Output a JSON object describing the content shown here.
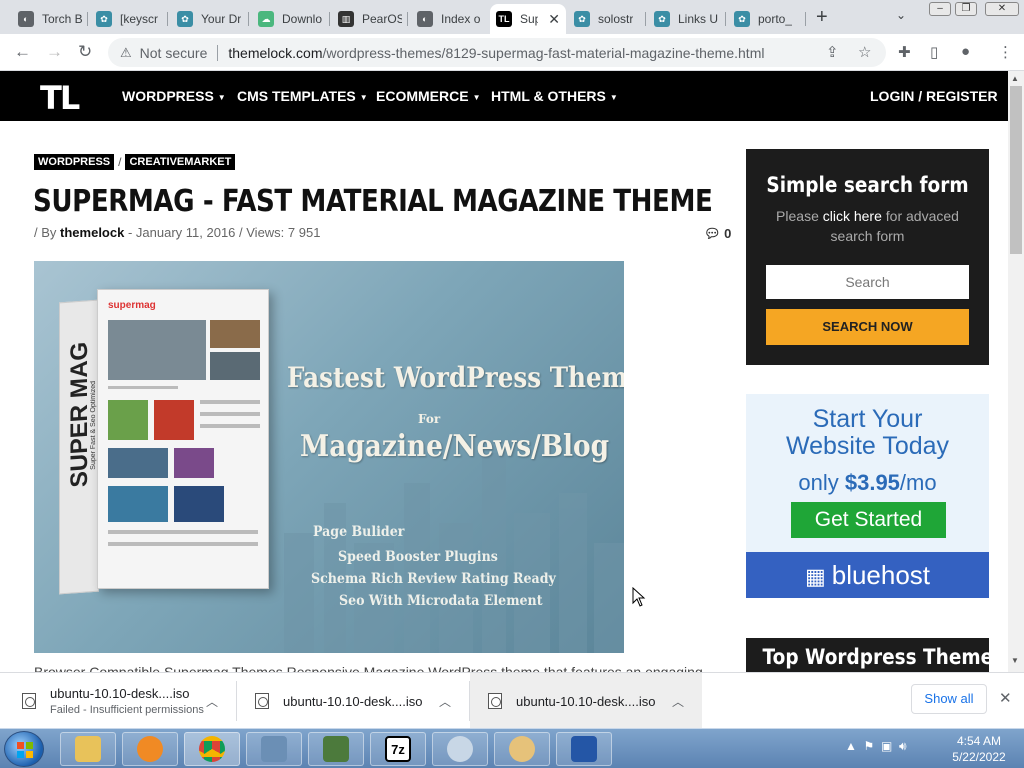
{
  "browser": {
    "tabs": [
      {
        "title": "Torch B",
        "color": "#5f6368",
        "glyph": "◐"
      },
      {
        "title": "[keyscr",
        "color": "#3b8ea5",
        "glyph": "✿"
      },
      {
        "title": "Your Dr",
        "color": "#3b8ea5",
        "glyph": "✿"
      },
      {
        "title": "Downlo",
        "color": "#4bb77e",
        "glyph": "☁"
      },
      {
        "title": "PearOS",
        "color": "#333333",
        "glyph": "▥"
      },
      {
        "title": "Index o",
        "color": "#5f6368",
        "glyph": "◐"
      },
      {
        "title": "Sup",
        "color": "#000000",
        "glyph": "TL"
      },
      {
        "title": "solostr",
        "color": "#3b8ea5",
        "glyph": "✿"
      },
      {
        "title": "Links U",
        "color": "#3b8ea5",
        "glyph": "✿"
      },
      {
        "title": "porto_",
        "color": "#3b8ea5",
        "glyph": "✿"
      }
    ],
    "security_label": "Not secure",
    "url_domain": "themelock.com",
    "url_path": "/wordpress-themes/8129-supermag-fast-material-magazine-theme.html"
  },
  "site": {
    "logo": "TL",
    "nav": [
      "WORDPRESS",
      "CMS TEMPLATES",
      "ECOMMERCE",
      "HTML & OTHERS"
    ],
    "login": "LOGIN / REGISTER"
  },
  "post": {
    "categories": [
      "WORDPRESS",
      "CREATIVEMARKET"
    ],
    "title": "SUPERMAG - FAST MATERIAL MAGAZINE THEME",
    "meta_by": "/ By",
    "author": "themelock",
    "meta_rest": "- January 11, 2016 / Views: 7 951",
    "comment_count": "0",
    "hero": {
      "box_title": "SUPER MAG",
      "box_sub": "Super Fast & Seo Optimized",
      "shot_logo": "supermag",
      "headline": "Fastest WordPress Themes",
      "for": "For",
      "subhead": "Magazine/News/Blog",
      "features": [
        "Page Bulider",
        "Speed Booster Plugins",
        "Schema Rich Review Rating Ready",
        "Seo With Microdata Element"
      ]
    },
    "excerpt": "Browser Compatible Supermag Themes Responsive Magazine WordPress theme that features an engaging"
  },
  "sidebar": {
    "search": {
      "title": "Simple search form",
      "sub_pre": "Please",
      "sub_link": "click here",
      "sub_post": "for advaced search form",
      "placeholder": "Search",
      "button": "SEARCH NOW"
    },
    "ad": {
      "line1": "Start Your",
      "line2": "Website Today",
      "price_pre": "only",
      "price": "$3.95",
      "price_post": "/mo",
      "button": "Get Started",
      "brand": "bluehost"
    },
    "top_themes_title": "Top Wordpress Themes"
  },
  "downloads": {
    "items": [
      {
        "name": "ubuntu-10.10-desk....iso",
        "status": "Failed - Insufficient permissions"
      },
      {
        "name": "ubuntu-10.10-desk....iso",
        "status": ""
      },
      {
        "name": "ubuntu-10.10-desk....iso",
        "status": ""
      }
    ],
    "show_all": "Show all"
  },
  "taskbar": {
    "time": "4:54 AM",
    "date": "5/22/2022"
  }
}
